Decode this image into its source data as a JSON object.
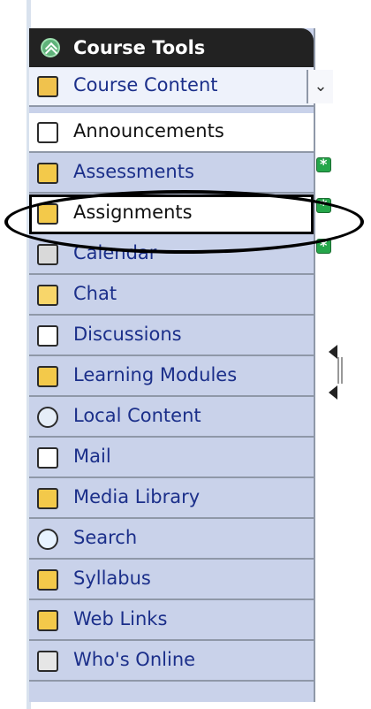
{
  "header": {
    "title": "Course Tools"
  },
  "items": [
    {
      "label": "Course Content"
    },
    {
      "label": "Announcements"
    },
    {
      "label": "Assessments"
    },
    {
      "label": "Assignments"
    },
    {
      "label": "Calendar"
    },
    {
      "label": "Chat"
    },
    {
      "label": "Discussions"
    },
    {
      "label": "Learning Modules"
    },
    {
      "label": "Local Content"
    },
    {
      "label": "Mail"
    },
    {
      "label": "Media Library"
    },
    {
      "label": "Search"
    },
    {
      "label": "Syllabus"
    },
    {
      "label": "Web Links"
    },
    {
      "label": "Who's Online"
    }
  ],
  "icons": {
    "header": "collapse-up-icon",
    "course_content": "home-icon",
    "announcements": "megaphone-icon",
    "assessments": "quiz-icon",
    "assignments": "pencil-paper-icon",
    "calendar": "calendar-icon",
    "chat": "chat-bubble-icon",
    "discussions": "pushpin-icon",
    "learning_modules": "modules-icon",
    "local_content": "cd-icon",
    "mail": "mail-icon",
    "media_library": "media-icon",
    "search": "magnifier-icon",
    "syllabus": "syllabus-icon",
    "web_links": "globe-link-icon",
    "whos_online": "monitor-icon"
  },
  "colors": {
    "header_bg": "#222222",
    "panel_bg": "#c9d2ea",
    "link": "#1b2f8a",
    "badge": "#25a64a"
  }
}
